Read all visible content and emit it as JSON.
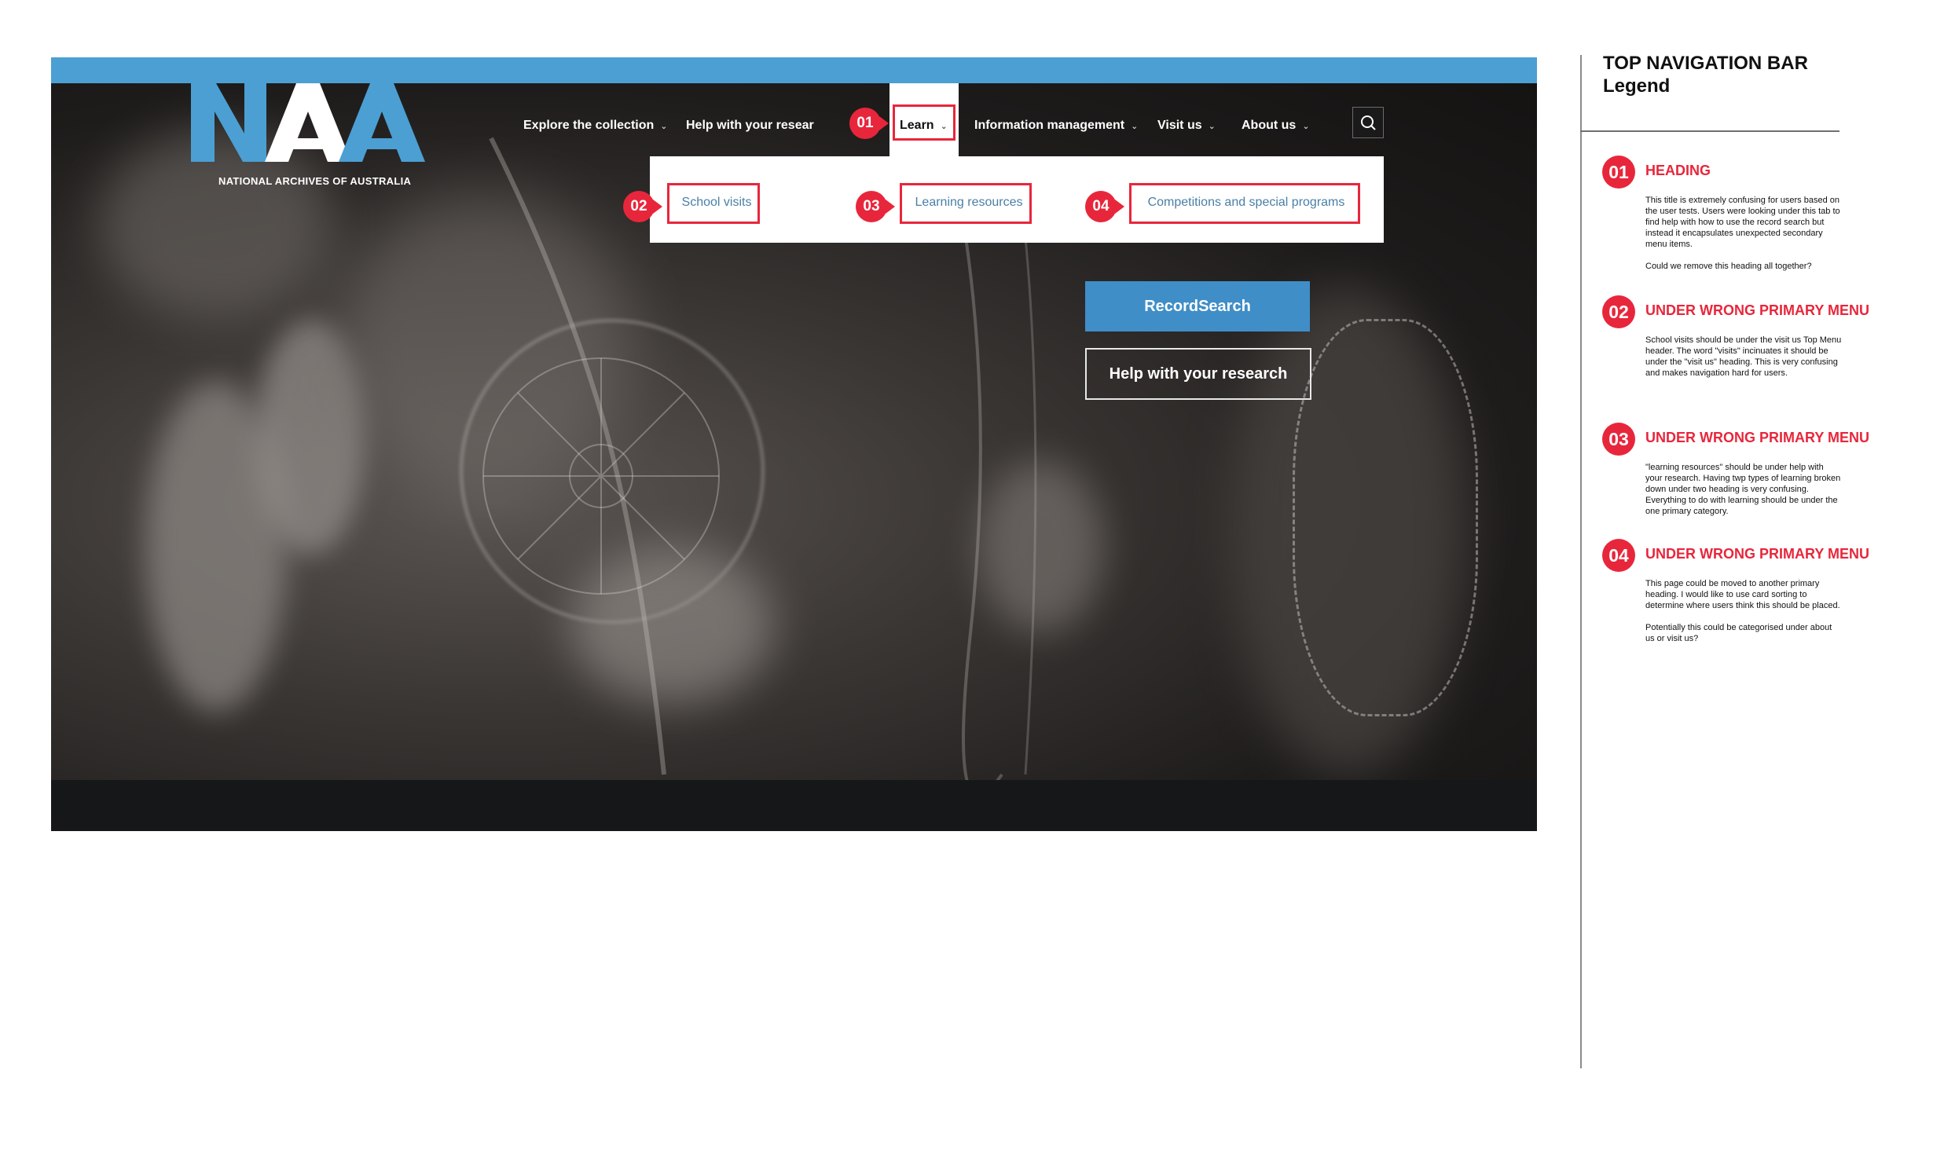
{
  "site": {
    "logo_letters": "NAA",
    "logo_tagline": "NATIONAL ARCHIVES OF AUSTRALIA"
  },
  "nav": {
    "items": [
      {
        "label": "Explore the collection"
      },
      {
        "label": "Help with your resear"
      },
      {
        "label": "Learn"
      },
      {
        "label": "Information management"
      },
      {
        "label": "Visit us"
      },
      {
        "label": "About us"
      }
    ],
    "chevron": "⌄",
    "search_icon": "search-icon"
  },
  "dropdown": {
    "items": [
      {
        "label": "School visits"
      },
      {
        "label": "Learning resources"
      },
      {
        "label": "Competitions and special programs"
      }
    ]
  },
  "hero": {
    "primary_button": "RecordSearch",
    "secondary_button": "Help with your research"
  },
  "markers": [
    "01",
    "02",
    "03",
    "04"
  ],
  "legend": {
    "title_line1": "TOP NAVIGATION BAR",
    "title_line2": "Legend",
    "entries": [
      {
        "num": "01",
        "heading": "HEADING",
        "paragraphs": [
          "This title is extremely confusing for users based on the user tests. Users were looking under this tab to find help with how to use the record search but instead it encapsulates unexpected secondary menu items.",
          "Could we remove this heading all together?"
        ]
      },
      {
        "num": "02",
        "heading": "UNDER WRONG PRIMARY MENU",
        "paragraphs": [
          "School visits should be under the visit us Top Menu header. The word \"visits\" incinuates it should be under the \"visit us\" heading. This is very confusing and makes navigation hard for users."
        ]
      },
      {
        "num": "03",
        "heading": "UNDER WRONG PRIMARY MENU",
        "paragraphs": [
          "\"learning resources\" should be under help with your research. Having twp types of learning broken down under two heading is very confusing. Everything to do with learning should be under the one primary category."
        ]
      },
      {
        "num": "04",
        "heading": "UNDER WRONG PRIMARY MENU",
        "paragraphs": [
          "This page could be moved to another primary heading. I would like to use card sorting to determine where users think this should be placed.",
          "Potentially this could be categorised under about us or visit us?"
        ]
      }
    ]
  },
  "colors": {
    "brand_blue": "#4b9fd3",
    "button_blue": "#3f8ec7",
    "annotation_red": "#e8263b",
    "dropdown_link": "#4a7fa6"
  }
}
